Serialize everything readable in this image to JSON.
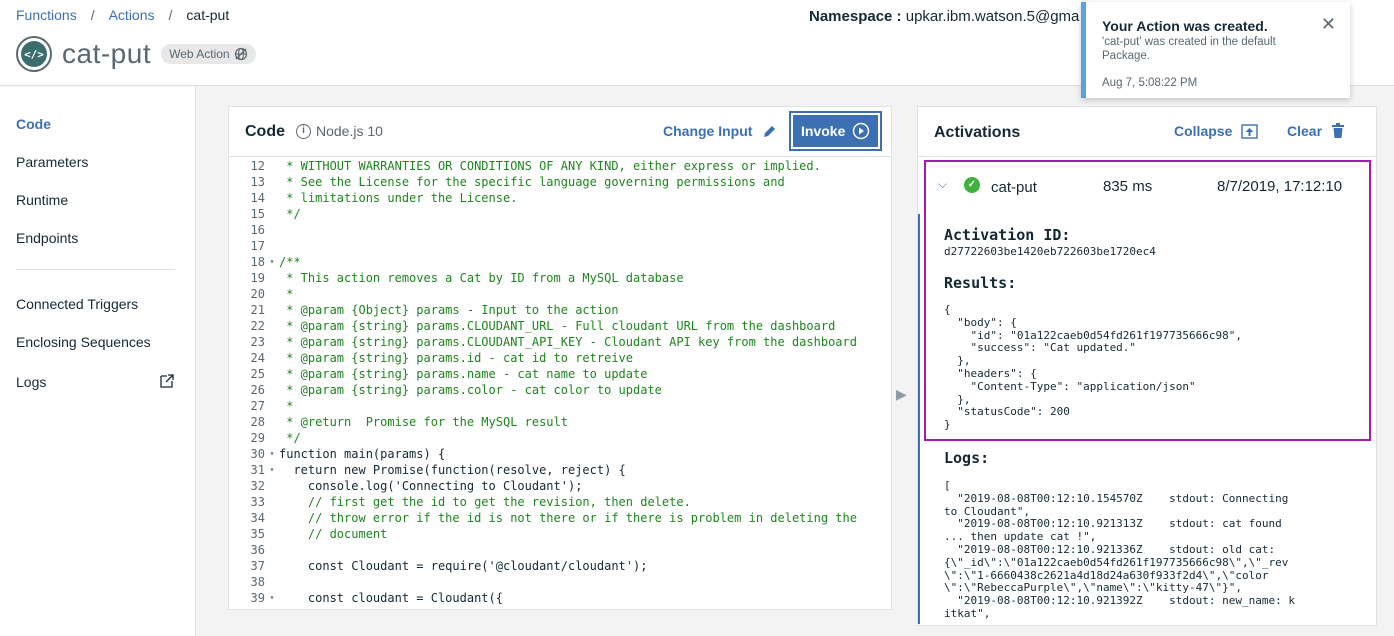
{
  "breadcrumb": {
    "items": [
      "Functions",
      "Actions"
    ],
    "current": "cat-put"
  },
  "header": {
    "title": "cat-put",
    "badge": "Web Action",
    "namespace_label": "Namespace :",
    "namespace_value": "upkar.ibm.watson.5@gma"
  },
  "toast": {
    "title": "Your Action was created.",
    "body": "'cat-put' was created in the default Package.",
    "time": "Aug 7, 5:08:22 PM"
  },
  "sidebar": {
    "items": [
      "Code",
      "Parameters",
      "Runtime",
      "Endpoints"
    ],
    "items2": [
      "Connected Triggers",
      "Enclosing Sequences",
      "Logs"
    ]
  },
  "code_panel": {
    "title": "Code",
    "runtime": "Node.js 10",
    "change_input": "Change Input",
    "invoke": "Invoke"
  },
  "code_lines": [
    {
      "n": "12",
      "f": "",
      "t": " * WITHOUT WARRANTIES OR CONDITIONS OF ANY KIND, either express or implied.",
      "c": "cm"
    },
    {
      "n": "13",
      "f": "",
      "t": " * See the License for the specific language governing permissions and",
      "c": "cm"
    },
    {
      "n": "14",
      "f": "",
      "t": " * limitations under the License.",
      "c": "cm"
    },
    {
      "n": "15",
      "f": "",
      "t": " */",
      "c": "cm"
    },
    {
      "n": "16",
      "f": "",
      "t": "",
      "c": "src"
    },
    {
      "n": "17",
      "f": "",
      "t": "",
      "c": "src"
    },
    {
      "n": "18",
      "f": "▾",
      "t": "/**",
      "c": "cm"
    },
    {
      "n": "19",
      "f": "",
      "t": " * This action removes a Cat by ID from a MySQL database",
      "c": "cm"
    },
    {
      "n": "20",
      "f": "",
      "t": " *",
      "c": "cm"
    },
    {
      "n": "21",
      "f": "",
      "t": " * @param {Object} params - Input to the action",
      "c": "cm"
    },
    {
      "n": "22",
      "f": "",
      "t": " * @param {string} params.CLOUDANT_URL - Full cloudant URL from the dashboard",
      "c": "cm"
    },
    {
      "n": "23",
      "f": "",
      "t": " * @param {string} params.CLOUDANT_API_KEY - Cloudant API key from the dashboard",
      "c": "cm"
    },
    {
      "n": "24",
      "f": "",
      "t": " * @param {string} params.id - cat id to retreive",
      "c": "cm"
    },
    {
      "n": "25",
      "f": "",
      "t": " * @param {string} params.name - cat name to update",
      "c": "cm"
    },
    {
      "n": "26",
      "f": "",
      "t": " * @param {string} params.color - cat color to update",
      "c": "cm"
    },
    {
      "n": "27",
      "f": "",
      "t": " *",
      "c": "cm"
    },
    {
      "n": "28",
      "f": "",
      "t": " * @return  Promise for the MySQL result",
      "c": "cm"
    },
    {
      "n": "29",
      "f": "",
      "t": " */",
      "c": "cm"
    },
    {
      "n": "30",
      "f": "▾",
      "t": "function main(params) {",
      "c": "src"
    },
    {
      "n": "31",
      "f": "▾",
      "t": "  return new Promise(function(resolve, reject) {",
      "c": "src"
    },
    {
      "n": "32",
      "f": "",
      "t": "    console.log('Connecting to Cloudant');",
      "c": "src"
    },
    {
      "n": "33",
      "f": "",
      "t": "    // first get the id to get the revision, then delete.",
      "c": "cm"
    },
    {
      "n": "34",
      "f": "",
      "t": "    // throw error if the id is not there or if there is problem in deleting the",
      "c": "cm"
    },
    {
      "n": "35",
      "f": "",
      "t": "    // document",
      "c": "cm"
    },
    {
      "n": "36",
      "f": "",
      "t": "",
      "c": "src"
    },
    {
      "n": "37",
      "f": "",
      "t": "    const Cloudant = require('@cloudant/cloudant');",
      "c": "src"
    },
    {
      "n": "38",
      "f": "",
      "t": "",
      "c": "src"
    },
    {
      "n": "39",
      "f": "▾",
      "t": "    const cloudant = Cloudant({",
      "c": "src"
    }
  ],
  "activations": {
    "title": "Activations",
    "collapse": "Collapse",
    "clear": "Clear",
    "entry": {
      "name": "cat-put",
      "duration": "835 ms",
      "date": "8/7/2019, 17:12:10"
    },
    "activation_id_label": "Activation ID:",
    "activation_id": "d27722603be1420eb722603be1720ec4",
    "results_label": "Results:",
    "results_text": "{\n  \"body\": {\n    \"id\": \"01a122caeb0d54fd261f197735666c98\",\n    \"success\": \"Cat updated.\"\n  },\n  \"headers\": {\n    \"Content-Type\": \"application/json\"\n  },\n  \"statusCode\": 200\n}",
    "logs_label": "Logs:",
    "logs_text": "[\n  \"2019-08-08T00:12:10.154570Z    stdout: Connecting\nto Cloudant\",\n  \"2019-08-08T00:12:10.921313Z    stdout: cat found\n... then update cat !\",\n  \"2019-08-08T00:12:10.921336Z    stdout: old cat:\n{\\\"_id\\\":\\\"01a122caeb0d54fd261f197735666c98\\\",\\\"_rev\n\\\":\\\"1-6660438c2621a4d18d24a630f933f2d4\\\",\\\"color\n\\\":\\\"RebeccaPurple\\\",\\\"name\\\":\\\"kitty-47\\\"}\",\n  \"2019-08-08T00:12:10.921392Z    stdout: new_name: k\nitkat\","
  }
}
